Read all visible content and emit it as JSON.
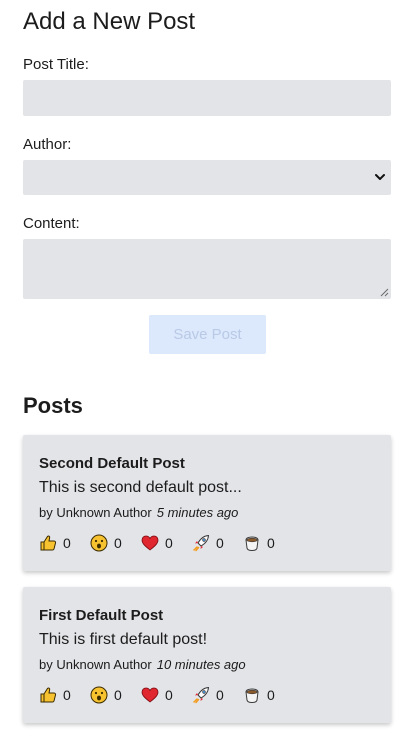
{
  "form": {
    "heading": "Add a New Post",
    "title_label": "Post Title:",
    "title_value": "",
    "author_label": "Author:",
    "author_selected": "",
    "content_label": "Content:",
    "content_value": "",
    "save_label": "Save Post"
  },
  "posts_heading": "Posts",
  "posts": [
    {
      "title": "Second Default Post",
      "excerpt": "This is second default post...",
      "author": "by Unknown Author",
      "time": "5 minutes ago",
      "reactions": [
        {
          "icon": "thumbs-up-icon",
          "count": "0"
        },
        {
          "icon": "surprised-face-icon",
          "count": "0"
        },
        {
          "icon": "heart-icon",
          "count": "0"
        },
        {
          "icon": "rocket-icon",
          "count": "0"
        },
        {
          "icon": "coffee-icon",
          "count": "0"
        }
      ]
    },
    {
      "title": "First Default Post",
      "excerpt": "This is first default post!",
      "author": "by Unknown Author",
      "time": "10 minutes ago",
      "reactions": [
        {
          "icon": "thumbs-up-icon",
          "count": "0"
        },
        {
          "icon": "surprised-face-icon",
          "count": "0"
        },
        {
          "icon": "heart-icon",
          "count": "0"
        },
        {
          "icon": "rocket-icon",
          "count": "0"
        },
        {
          "icon": "coffee-icon",
          "count": "0"
        }
      ]
    }
  ],
  "colors": {
    "field_background": "#e3e4e8",
    "save_button_background": "#dce8fb",
    "save_button_text": "#b9c9e6",
    "heart": "#e0262f",
    "thumb": "#f7c230"
  }
}
